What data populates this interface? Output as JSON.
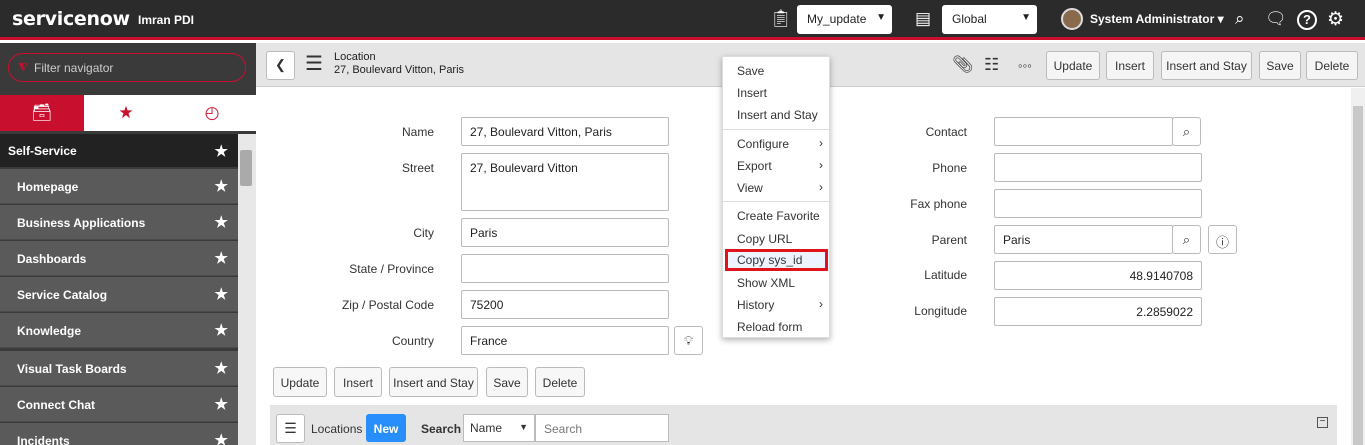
{
  "header": {
    "brand": "servicenow",
    "instance": "Imran PDI",
    "update_set": "My_update",
    "scope": "Global",
    "user": "System Administrator"
  },
  "nav": {
    "filter_placeholder": "Filter navigator",
    "section": "Self-Service",
    "items": [
      "Homepage",
      "Business Applications",
      "Dashboards",
      "Service Catalog",
      "Knowledge",
      "Visual Task Boards",
      "Connect Chat",
      "Incidents"
    ]
  },
  "form_header": {
    "table": "Location",
    "record": "27, Boulevard Vitton, Paris",
    "buttons": [
      "Update",
      "Insert",
      "Insert and Stay",
      "Save",
      "Delete"
    ]
  },
  "form": {
    "left": {
      "name_label": "Name",
      "name": "27, Boulevard Vitton, Paris",
      "street_label": "Street",
      "street": "27, Boulevard Vitton",
      "city_label": "City",
      "city": "Paris",
      "state_label": "State / Province",
      "state": "",
      "zip_label": "Zip / Postal Code",
      "zip": "75200",
      "country_label": "Country",
      "country": "France"
    },
    "right": {
      "contact_label": "Contact",
      "contact": "",
      "phone_label": "Phone",
      "phone": "",
      "fax_label": "Fax phone",
      "fax": "",
      "parent_label": "Parent",
      "parent": "Paris",
      "latitude_label": "Latitude",
      "latitude": "48.9140708",
      "longitude_label": "Longitude",
      "longitude": "2.2859022"
    },
    "buttons": [
      "Update",
      "Insert",
      "Insert and Stay",
      "Save",
      "Delete"
    ]
  },
  "related_list": {
    "title": "Locations",
    "new": "New",
    "search_label": "Search",
    "field": "Name",
    "search_placeholder": "Search"
  },
  "context_menu": {
    "items": [
      "Save",
      "Insert",
      "Insert and Stay",
      "Configure",
      "Export",
      "View",
      "Create Favorite",
      "Copy URL",
      "Copy sys_id",
      "Show XML",
      "History",
      "Reload form"
    ],
    "highlighted": "Copy sys_id"
  },
  "colors": {
    "brand_red": "#c8102e",
    "new_blue": "#278efc",
    "highlight": "#e0121c"
  }
}
